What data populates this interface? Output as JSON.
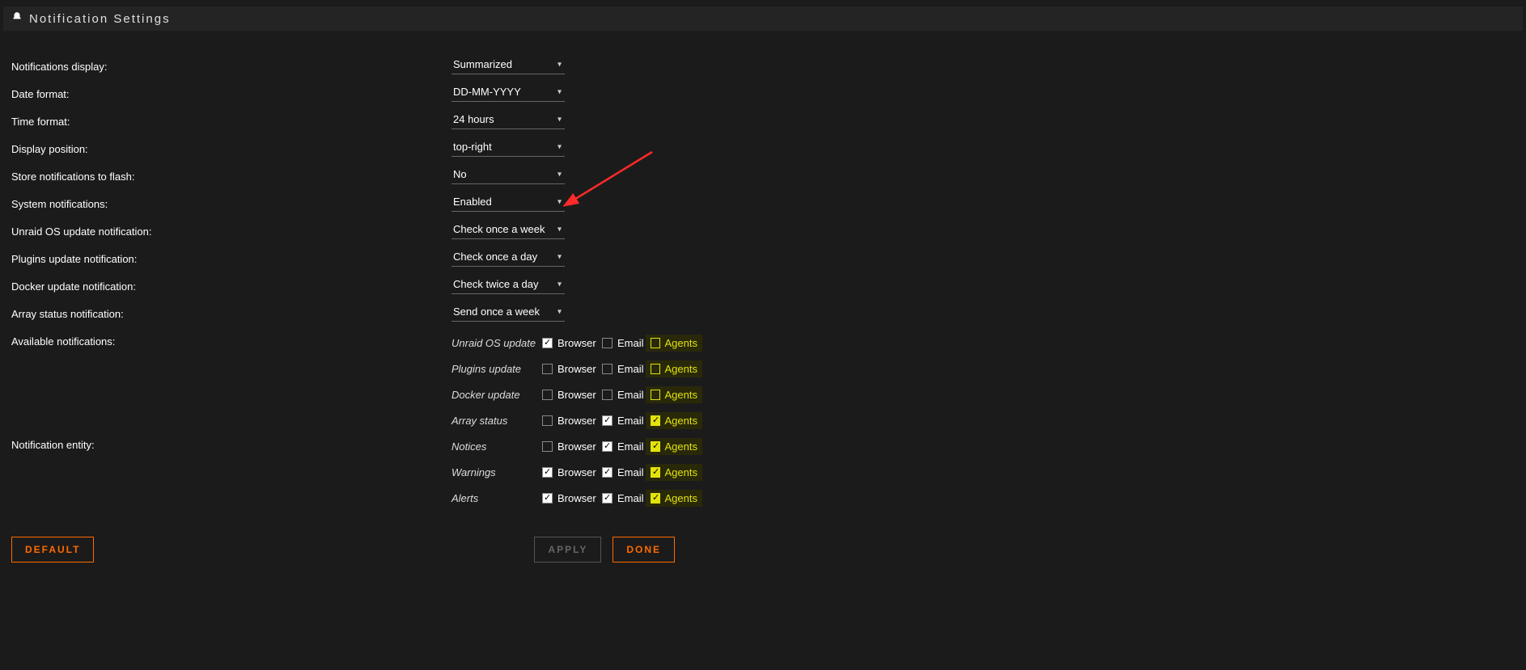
{
  "header": {
    "title": "Notification Settings"
  },
  "settings": {
    "notifications_display": {
      "label": "Notifications display:",
      "value": "Summarized"
    },
    "date_format": {
      "label": "Date format:",
      "value": "DD-MM-YYYY"
    },
    "time_format": {
      "label": "Time format:",
      "value": "24 hours"
    },
    "display_position": {
      "label": "Display position:",
      "value": "top-right"
    },
    "store_to_flash": {
      "label": "Store notifications to flash:",
      "value": "No"
    },
    "system_notifications": {
      "label": "System notifications:",
      "value": "Enabled"
    },
    "os_update": {
      "label": "Unraid OS update notification:",
      "value": "Check once a week"
    },
    "plugins_update": {
      "label": "Plugins update notification:",
      "value": "Check once a day"
    },
    "docker_update": {
      "label": "Docker update notification:",
      "value": "Check twice a day"
    },
    "array_status": {
      "label": "Array status notification:",
      "value": "Send once a week"
    }
  },
  "available_notifications": {
    "label": "Available notifications:",
    "col_browser": "Browser",
    "col_email": "Email",
    "col_agents": "Agents",
    "rows": [
      {
        "name": "Unraid OS update",
        "browser": true,
        "email": false,
        "agents": false
      },
      {
        "name": "Plugins update",
        "browser": false,
        "email": false,
        "agents": false
      },
      {
        "name": "Docker update",
        "browser": false,
        "email": false,
        "agents": false
      },
      {
        "name": "Array status",
        "browser": false,
        "email": true,
        "agents": true
      }
    ]
  },
  "notification_entity": {
    "label": "Notification entity:",
    "col_browser": "Browser",
    "col_email": "Email",
    "col_agents": "Agents",
    "rows": [
      {
        "name": "Notices",
        "browser": false,
        "email": true,
        "agents": true
      },
      {
        "name": "Warnings",
        "browser": true,
        "email": true,
        "agents": true
      },
      {
        "name": "Alerts",
        "browser": true,
        "email": true,
        "agents": true
      }
    ]
  },
  "buttons": {
    "default": "DEFAULT",
    "apply": "APPLY",
    "done": "DONE"
  }
}
